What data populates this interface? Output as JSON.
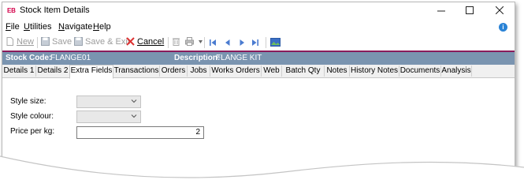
{
  "window": {
    "logo": "EB",
    "title": "Stock Item Details",
    "controls": [
      "minimize",
      "maximize",
      "close"
    ]
  },
  "menu": {
    "items": [
      {
        "first": "F",
        "rest": "ile"
      },
      {
        "first": "U",
        "rest": "tilities"
      },
      {
        "first": "N",
        "rest": "avigate"
      },
      {
        "first": "H",
        "rest": "elp"
      }
    ]
  },
  "toolbar": {
    "new_label": "New",
    "save_label": "Save",
    "save_exit_label": "Save & Exit",
    "cancel_label": "Cancel"
  },
  "header": {
    "stock_code_label": "Stock Code:",
    "stock_code_value": "FLANGE01",
    "description_label": "Description:",
    "description_value": "FLANGE KIT"
  },
  "tabs": [
    {
      "label": "Details 1"
    },
    {
      "label": "Details 2"
    },
    {
      "label": "Extra Fields",
      "active": true
    },
    {
      "label": "Transactions"
    },
    {
      "label": "Orders"
    },
    {
      "label": "Jobs"
    },
    {
      "label": "Works Orders"
    },
    {
      "label": "Web"
    },
    {
      "label": "Batch Qty"
    },
    {
      "label": "Notes"
    },
    {
      "label": "History Notes"
    },
    {
      "label": "Documents"
    },
    {
      "label": "Analysis"
    }
  ],
  "fields": {
    "style_size_label": "Style size:",
    "style_size_value": "",
    "style_colour_label": "Style colour:",
    "style_colour_value": "",
    "price_per_kg_label": "Price per kg:",
    "price_per_kg_value": "2"
  },
  "colors": {
    "accent": "#8a1b5b",
    "header_bar": "#7a94b0",
    "logo": "#d4004a"
  }
}
